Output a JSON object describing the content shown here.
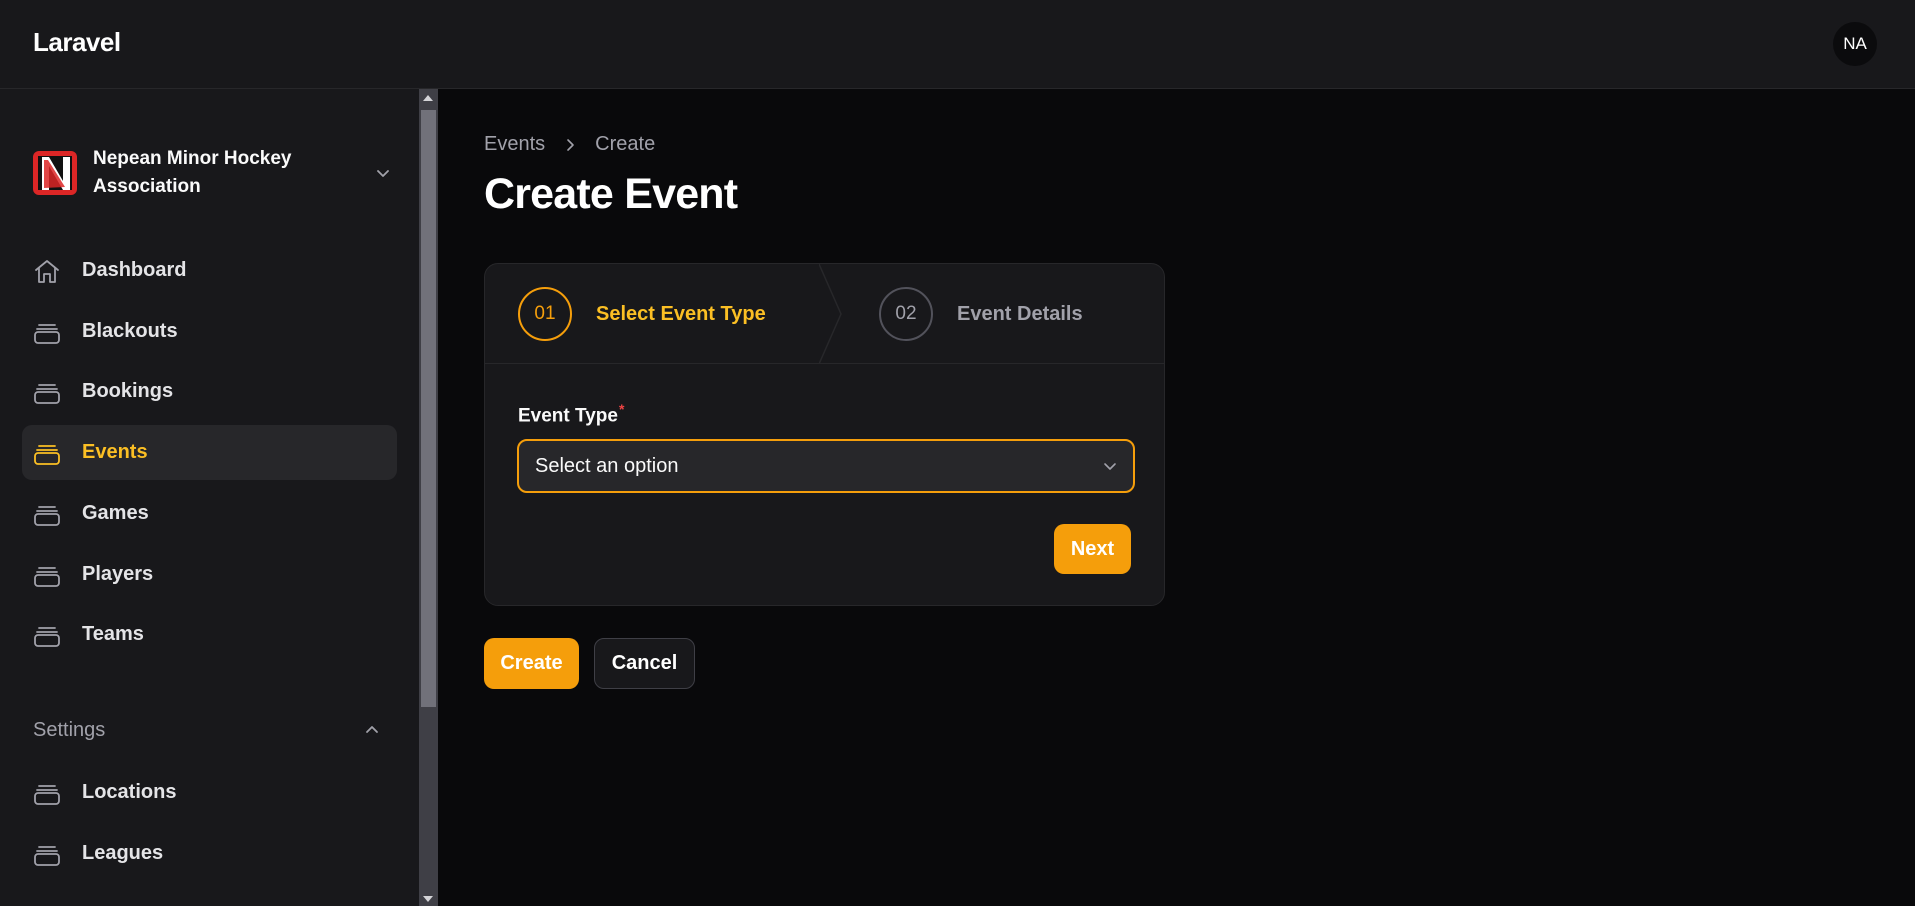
{
  "app": {
    "brand": "Laravel",
    "user_initials": "NA"
  },
  "tenant": {
    "name": "Nepean Minor Hockey Association",
    "logo_letter": "N"
  },
  "sidebar": {
    "items": [
      {
        "label": "Dashboard",
        "icon": "home-icon",
        "active": false
      },
      {
        "label": "Blackouts",
        "icon": "collection-icon",
        "active": false
      },
      {
        "label": "Bookings",
        "icon": "collection-icon",
        "active": false
      },
      {
        "label": "Events",
        "icon": "collection-icon",
        "active": true
      },
      {
        "label": "Games",
        "icon": "collection-icon",
        "active": false
      },
      {
        "label": "Players",
        "icon": "collection-icon",
        "active": false
      },
      {
        "label": "Teams",
        "icon": "collection-icon",
        "active": false
      }
    ],
    "settings_group": {
      "label": "Settings",
      "items": [
        {
          "label": "Locations",
          "icon": "collection-icon"
        },
        {
          "label": "Leagues",
          "icon": "collection-icon"
        }
      ]
    }
  },
  "breadcrumb": {
    "parent": "Events",
    "current": "Create"
  },
  "page": {
    "title": "Create Event"
  },
  "wizard": {
    "steps": [
      {
        "number": "01",
        "label": "Select Event Type",
        "state": "current"
      },
      {
        "number": "02",
        "label": "Event Details",
        "state": "upcoming"
      }
    ],
    "field": {
      "label": "Event Type",
      "required_mark": "*",
      "placeholder": "Select an option"
    },
    "next_label": "Next"
  },
  "actions": {
    "create_label": "Create",
    "cancel_label": "Cancel"
  },
  "colors": {
    "accent": "#f59e0b",
    "background": "#09090b",
    "panel": "#18181b"
  }
}
